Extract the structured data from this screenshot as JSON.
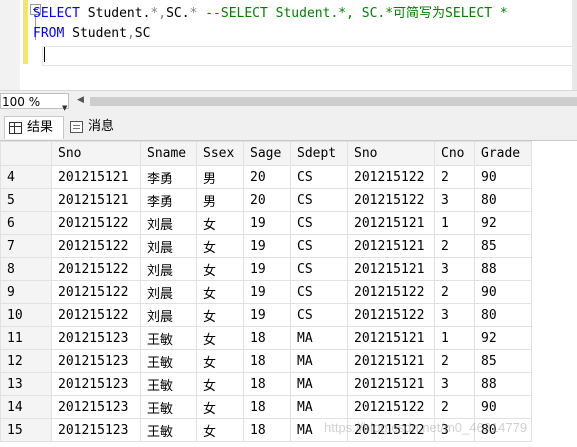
{
  "editor": {
    "line1": {
      "kw_select": "SELECT",
      "text_a": " Student.",
      "star1": "*",
      "comma": ",",
      "text_b": "SC.",
      "star2": "*",
      "comment": " --SELECT Student.*, SC.*可简写为SELECT *"
    },
    "line2": {
      "kw_from": "FROM",
      "text": " Student",
      "comma": ",",
      "text2": "SC"
    }
  },
  "zoom": {
    "value": "100 %"
  },
  "tabs": {
    "results": "结果",
    "messages": "消息"
  },
  "grid": {
    "columns": [
      "Sno",
      "Sname",
      "Ssex",
      "Sage",
      "Sdept",
      "Sno",
      "Cno",
      "Grade"
    ],
    "rows": [
      {
        "n": "4",
        "cells": [
          "201215121",
          "李勇",
          "男",
          "20",
          "CS",
          "201215122",
          "2",
          "90"
        ]
      },
      {
        "n": "5",
        "cells": [
          "201215121",
          "李勇",
          "男",
          "20",
          "CS",
          "201215122",
          "3",
          "80"
        ]
      },
      {
        "n": "6",
        "cells": [
          "201215122",
          "刘晨",
          "女",
          "19",
          "CS",
          "201215121",
          "1",
          "92"
        ]
      },
      {
        "n": "7",
        "cells": [
          "201215122",
          "刘晨",
          "女",
          "19",
          "CS",
          "201215121",
          "2",
          "85"
        ]
      },
      {
        "n": "8",
        "cells": [
          "201215122",
          "刘晨",
          "女",
          "19",
          "CS",
          "201215121",
          "3",
          "88"
        ]
      },
      {
        "n": "9",
        "cells": [
          "201215122",
          "刘晨",
          "女",
          "19",
          "CS",
          "201215122",
          "2",
          "90"
        ]
      },
      {
        "n": "10",
        "cells": [
          "201215122",
          "刘晨",
          "女",
          "19",
          "CS",
          "201215122",
          "3",
          "80"
        ]
      },
      {
        "n": "11",
        "cells": [
          "201215123",
          "王敏",
          "女",
          "18",
          "MA",
          "201215121",
          "1",
          "92"
        ]
      },
      {
        "n": "12",
        "cells": [
          "201215123",
          "王敏",
          "女",
          "18",
          "MA",
          "201215121",
          "2",
          "85"
        ]
      },
      {
        "n": "13",
        "cells": [
          "201215123",
          "王敏",
          "女",
          "18",
          "MA",
          "201215121",
          "3",
          "88"
        ]
      },
      {
        "n": "14",
        "cells": [
          "201215123",
          "王敏",
          "女",
          "18",
          "MA",
          "201215122",
          "2",
          "90"
        ]
      },
      {
        "n": "15",
        "cells": [
          "201215123",
          "王敏",
          "女",
          "18",
          "MA",
          "201215122",
          "3",
          "80"
        ]
      }
    ]
  },
  "watermark": "https://blog.csdn.net/m0_46314779",
  "colors": {
    "keyword": "#0000ff",
    "comment": "#008000",
    "operator": "#808080",
    "changebar": "#f5e36b"
  }
}
